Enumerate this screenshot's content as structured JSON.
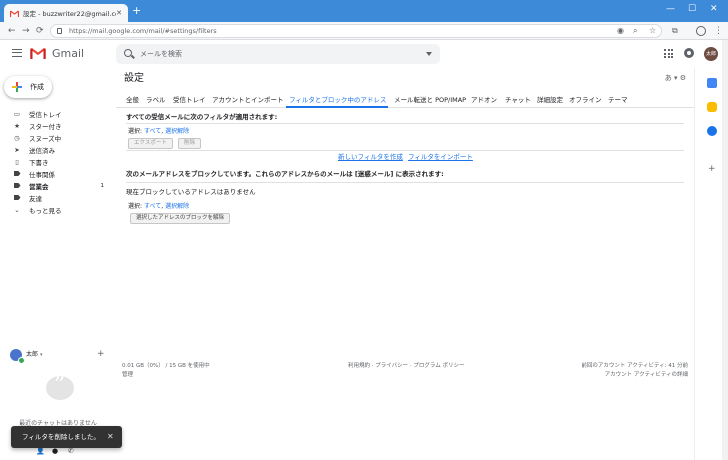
{
  "browser": {
    "tab_title": "設定 - buzzwriter22@gmail.com",
    "tab_close": "✕",
    "new_tab": "+",
    "url": "https://mail.google.com/mail/#settings/filters",
    "win_min": "—",
    "win_max": "☐",
    "win_close": "✕",
    "back": "←",
    "forward": "→",
    "reload": "⟳",
    "menu": "⋮"
  },
  "header": {
    "brand": "Gmail",
    "search_placeholder": "メールを検索",
    "avatar_text": "太郎"
  },
  "sidebar": {
    "compose": "作成",
    "items": [
      {
        "label": "受信トレイ",
        "icon": "▭",
        "count": ""
      },
      {
        "label": "スター付き",
        "icon": "★",
        "count": ""
      },
      {
        "label": "スヌーズ中",
        "icon": "◷",
        "count": ""
      },
      {
        "label": "送信済み",
        "icon": "➤",
        "count": ""
      },
      {
        "label": "下書き",
        "icon": "▯",
        "count": ""
      },
      {
        "label": "仕事関係",
        "icon": "",
        "count": ""
      },
      {
        "label": "営業会",
        "icon": "",
        "count": "1"
      },
      {
        "label": "友達",
        "icon": "",
        "count": ""
      },
      {
        "label": "もっと見る",
        "icon": "⌄",
        "count": ""
      }
    ],
    "chat_user": "太郎",
    "chat_caret": "▾",
    "chat_add": "+",
    "no_chats": "最近のチャットはありません"
  },
  "main": {
    "title": "設定",
    "lang": "あ ▾ ⚙",
    "tabs": [
      "全般",
      "ラベル",
      "受信トレイ",
      "アカウントとインポート",
      "フィルタとブロック中のアドレス",
      "メール転送と POP/IMAP",
      "アドオン",
      "チャット",
      "詳細設定",
      "オフライン",
      "テーマ"
    ],
    "filters_heading": "すべての受信メールに次のフィルタが適用されます:",
    "select_label": "選択:",
    "select_all": "すべて",
    "select_none": "選択解除",
    "export_button": "エクスポート",
    "delete_button": "削除",
    "new_filter_link": "新しいフィルタを作成",
    "import_filter_link": "フィルタをインポート",
    "blocked_heading": "次のメールアドレスをブロックしています。これらのアドレスからのメールは [迷惑メール] に表示されます:",
    "no_blocked": "現在ブロックしているアドレスはありません",
    "unblock_button": "選択したアドレスのブロックを解除"
  },
  "footer": {
    "storage": "0.01 GB（0%） / 15 GB を使用中",
    "manage": "管理",
    "terms": "利用規約 · プライバシー · プログラム ポリシー",
    "activity": "前回のアカウント アクティビティ: 41 分前",
    "activity_detail": "アカウント アクティビティの詳細"
  },
  "toast": {
    "message": "フィルタを削除しました。",
    "close": "✕"
  },
  "colors": {
    "chrome_tab_bar": "#3c8ad8",
    "accent": "#1a73e8",
    "toast_bg": "#323232"
  }
}
